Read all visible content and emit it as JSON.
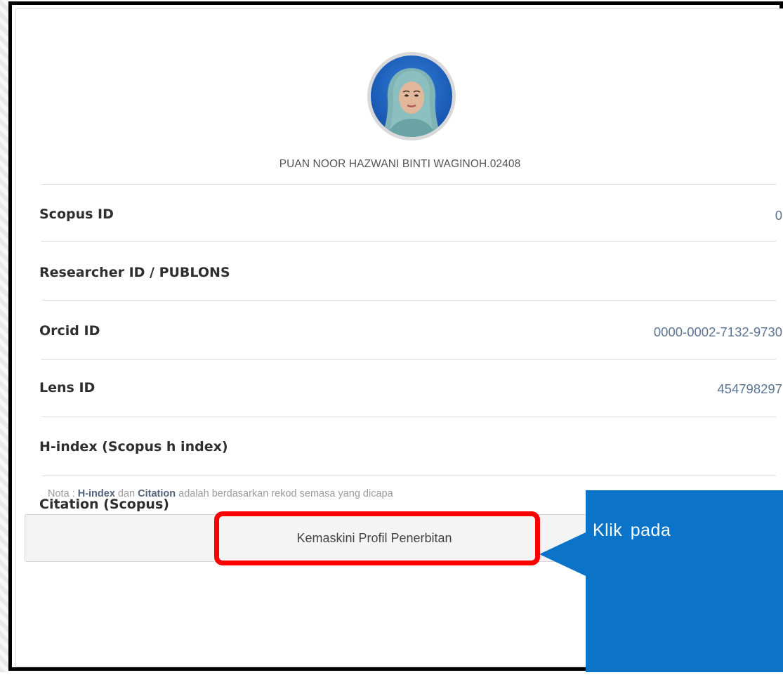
{
  "profile": {
    "name": "PUAN NOOR HAZWANI BINTI WAGINOH.02408"
  },
  "fields": [
    {
      "label": "Scopus ID",
      "value": "0"
    },
    {
      "label": "Researcher ID / PUBLONS",
      "value": ""
    },
    {
      "label": "Orcid ID",
      "value": "0000-0002-7132-9730"
    },
    {
      "label": "Lens ID",
      "value": "454798297"
    },
    {
      "label": "H-index (Scopus h index)",
      "value": ""
    },
    {
      "label": "Citation (Scopus)",
      "value": ""
    }
  ],
  "note": {
    "prefix": "Nota : ",
    "hindex": "H-index",
    "dan": " dan ",
    "citation": "Citation",
    "rest": " adalah berdasarkan rekod semasa yang dicapa"
  },
  "actions": {
    "update_profile_label": "Kemaskini Profil Penerbitan"
  },
  "annotation": {
    "callout_text": "Klik pada",
    "callout_color": "#0b74c9",
    "highlight_color": "#ff0000"
  }
}
